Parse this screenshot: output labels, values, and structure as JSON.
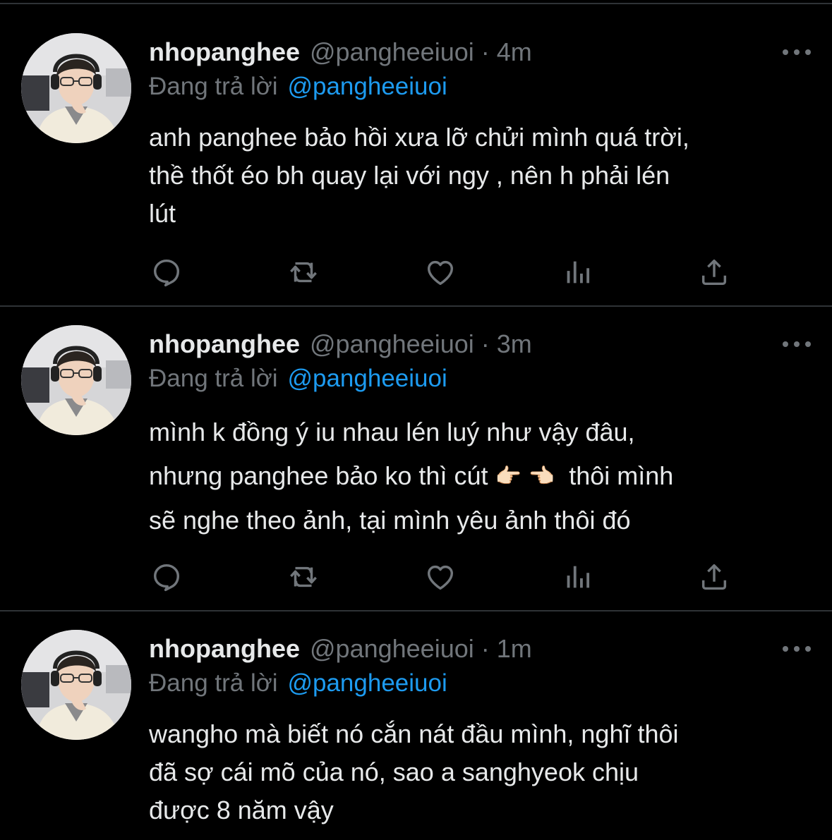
{
  "colors": {
    "background": "#000000",
    "text": "#e7e9ea",
    "secondary": "#71767b",
    "link": "#1d9bf0",
    "divider": "#2f3336"
  },
  "tweets": [
    {
      "display_name": "nhopanghee",
      "handle": "@pangheeiuoi",
      "separator": "·",
      "time": "4m",
      "reply_prefix": "Đang trả lời",
      "reply_to": "@pangheeiuoi",
      "body": {
        "line1": "anh panghee bảo hồi xưa lỡ chửi mình quá trời,",
        "line2": "thề thốt éo bh quay lại với ngy , nên h phải lén",
        "line3": "lút"
      },
      "icons": {
        "avatar": "avatar-photo",
        "more": "more-icon",
        "reply": "reply-icon",
        "retweet": "retweet-icon",
        "like": "heart-icon",
        "analytics": "analytics-icon",
        "share": "share-icon"
      }
    },
    {
      "display_name": "nhopanghee",
      "handle": "@pangheeiuoi",
      "separator": "·",
      "time": "3m",
      "reply_prefix": "Đang trả lời",
      "reply_to": "@pangheeiuoi",
      "body": {
        "line1": "mình k đồng ý iu nhau lén luý như vậy đâu,",
        "line2_before": "nhưng panghee bảo ko thì cút ",
        "emoji_1": "👉🏻",
        "emoji_2": "👈🏻",
        "line2_after": "  thôi mình",
        "line3": "sẽ nghe theo ảnh, tại mình yêu ảnh thôi đó"
      },
      "icons": {
        "avatar": "avatar-photo",
        "more": "more-icon",
        "reply": "reply-icon",
        "retweet": "retweet-icon",
        "like": "heart-icon",
        "analytics": "analytics-icon",
        "share": "share-icon"
      }
    },
    {
      "display_name": "nhopanghee",
      "handle": "@pangheeiuoi",
      "separator": "·",
      "time": "1m",
      "reply_prefix": "Đang trả lời",
      "reply_to": "@pangheeiuoi",
      "body": {
        "line1": "wangho mà biết nó cắn nát đầu mình, nghĩ thôi",
        "line2": "đã sợ cái mõ của nó, sao a sanghyeok chịu",
        "line3": "được 8 năm vậy"
      },
      "icons": {
        "avatar": "avatar-photo",
        "more": "more-icon"
      }
    }
  ]
}
